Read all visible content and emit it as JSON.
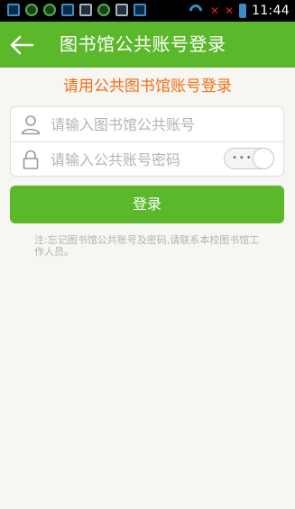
{
  "status_bar": {
    "time": "11:44",
    "icons": [
      "notification-icon",
      "notification-icon",
      "notification-icon",
      "notification-icon",
      "notification-icon",
      "notification-icon",
      "notification-icon",
      "notification-icon",
      "wifi-icon",
      "no-signal-icon",
      "no-signal-icon",
      "battery-icon"
    ]
  },
  "appbar": {
    "title": "图书馆公共账号登录",
    "back_icon": "back-arrow-icon",
    "color": "#5bb82b"
  },
  "form": {
    "heading": "请用公共图书馆账号登录",
    "heading_color": "#f06f13",
    "account_placeholder": "请输入图书馆公共账号",
    "account_value": "",
    "password_placeholder": "请输入公共账号密码",
    "password_value": "",
    "show_password_toggle": "•••",
    "user_icon": "user-icon",
    "lock_icon": "lock-icon"
  },
  "login_button": {
    "label": "登录",
    "color": "#5bb82b"
  },
  "note": "注:忘记图书馆公共账号及密码,请联系本校图书馆工作人员。"
}
